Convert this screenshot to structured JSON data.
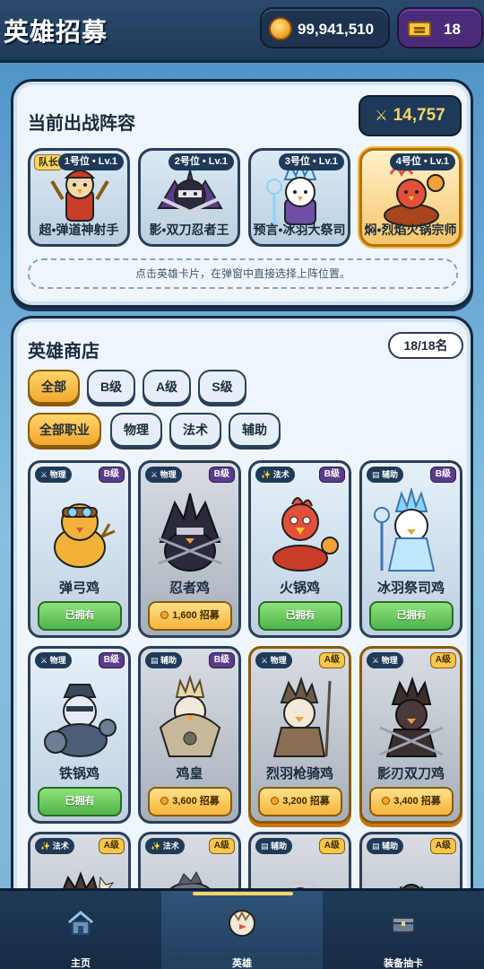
{
  "header": {
    "title": "英雄招募",
    "coins": "99,941,510",
    "tickets": "18"
  },
  "lineup": {
    "title": "当前出战阵容",
    "power": "14,757",
    "slots": [
      {
        "tag": "1号位 • Lv.1",
        "captain": "队长",
        "name": "超•弹道神射手"
      },
      {
        "tag": "2号位 • Lv.1",
        "name": "影•双刀忍者王"
      },
      {
        "tag": "3号位 • Lv.1",
        "name": "预言•冰羽大祭司"
      },
      {
        "tag": "4号位 • Lv.1",
        "name": "焖•烈焰火锅宗师"
      }
    ],
    "hint": "点击英雄卡片，在弹窗中直接选择上阵位置。"
  },
  "shop": {
    "title": "英雄商店",
    "count": "18/18名",
    "grade_filters": [
      "全部",
      "B级",
      "A级",
      "S级"
    ],
    "class_filters": [
      "全部职业",
      "物理",
      "法术",
      "辅助"
    ],
    "heroes": [
      {
        "type": "物理",
        "rank": "B级",
        "name": "弹弓鸡",
        "action": "已拥有"
      },
      {
        "type": "物理",
        "rank": "B级",
        "name": "忍者鸡",
        "action": "1,600 招募"
      },
      {
        "type": "法术",
        "rank": "B级",
        "name": "火锅鸡",
        "action": "已拥有"
      },
      {
        "type": "辅助",
        "rank": "B级",
        "name": "冰羽祭司鸡",
        "action": "已拥有"
      },
      {
        "type": "物理",
        "rank": "B级",
        "name": "铁锅鸡",
        "action": "已拥有"
      },
      {
        "type": "辅助",
        "rank": "B级",
        "name": "鸡皇",
        "action": "3,600 招募"
      },
      {
        "type": "物理",
        "rank": "A级",
        "name": "烈羽枪骑鸡",
        "action": "3,200 招募"
      },
      {
        "type": "物理",
        "rank": "A级",
        "name": "影刃双刀鸡",
        "action": "3,400 招募"
      },
      {
        "type": "法术",
        "rank": "A级"
      },
      {
        "type": "法术",
        "rank": "A级"
      },
      {
        "type": "辅助",
        "rank": "A级"
      },
      {
        "type": "辅助",
        "rank": "A级"
      }
    ]
  },
  "nav": {
    "items": [
      "主页",
      "英雄",
      "装备抽卡"
    ],
    "active": "英雄"
  },
  "colors": {
    "gold": "#f6d46b",
    "panel": "#eef5fb",
    "navy": "#1f3a58",
    "owned_green": "#4fb34a",
    "recruit_orange": "#f5b43a"
  }
}
